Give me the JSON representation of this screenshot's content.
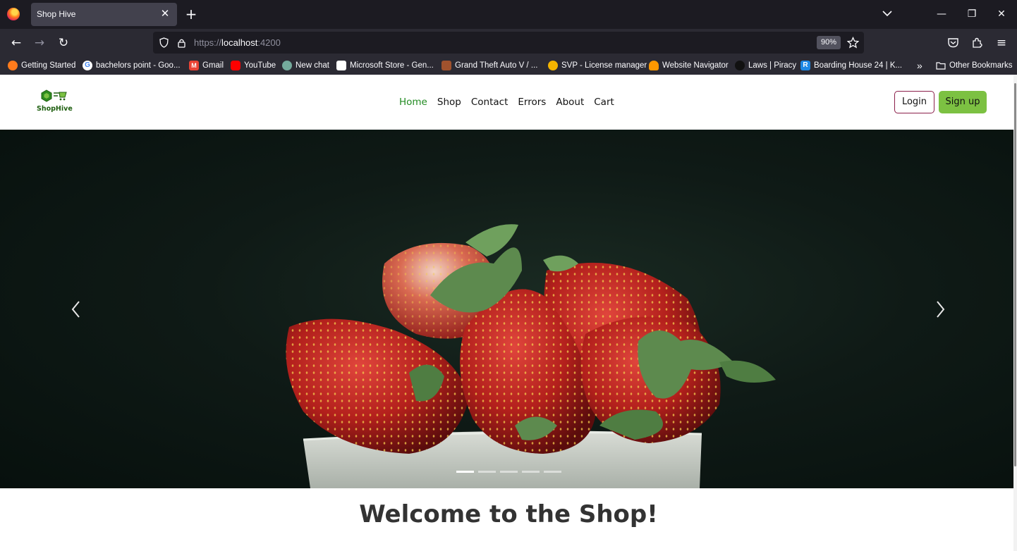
{
  "browser": {
    "tab_title": "Shop Hive",
    "url_scheme": "https://",
    "url_host": "localhost",
    "url_port": ":4200",
    "zoom": "90%",
    "bookmarks": [
      {
        "label": "Getting Started",
        "icon_color": "#ff7b1c"
      },
      {
        "label": "bachelors point - Goo...",
        "icon_color": "#ffffff"
      },
      {
        "label": "Gmail",
        "icon_color": "#ea4335"
      },
      {
        "label": "YouTube",
        "icon_color": "#ff0000"
      },
      {
        "label": "New chat",
        "icon_color": "#74aa9c"
      },
      {
        "label": "Microsoft Store - Gen...",
        "icon_color": "#ffffff"
      },
      {
        "label": "Grand Theft Auto V / ...",
        "icon_color": "#a0522d"
      },
      {
        "label": "SVP - License manager",
        "icon_color": "#f4b400"
      },
      {
        "label": "Website Navigator",
        "icon_color": "#ff9800"
      },
      {
        "label": "Laws | Piracy",
        "icon_color": "#222222"
      },
      {
        "label": "Boarding House 24 | K...",
        "icon_color": "#1e88e5"
      }
    ],
    "other_bookmarks": "Other Bookmarks"
  },
  "site": {
    "logo_text": "ShopHive",
    "menu": [
      {
        "label": "Home",
        "active": true
      },
      {
        "label": "Shop",
        "active": false
      },
      {
        "label": "Contact",
        "active": false
      },
      {
        "label": "Errors",
        "active": false
      },
      {
        "label": "About",
        "active": false
      },
      {
        "label": "Cart",
        "active": false
      }
    ],
    "login_label": "Login",
    "signup_label": "Sign up",
    "accent_color": "#7cc142",
    "active_link_color": "#228b22"
  },
  "carousel": {
    "slide_count": 5,
    "active_index": 0,
    "prev_icon": "chevron-left-icon",
    "next_icon": "chevron-right-icon"
  },
  "welcome_title": "Welcome to the Shop!"
}
